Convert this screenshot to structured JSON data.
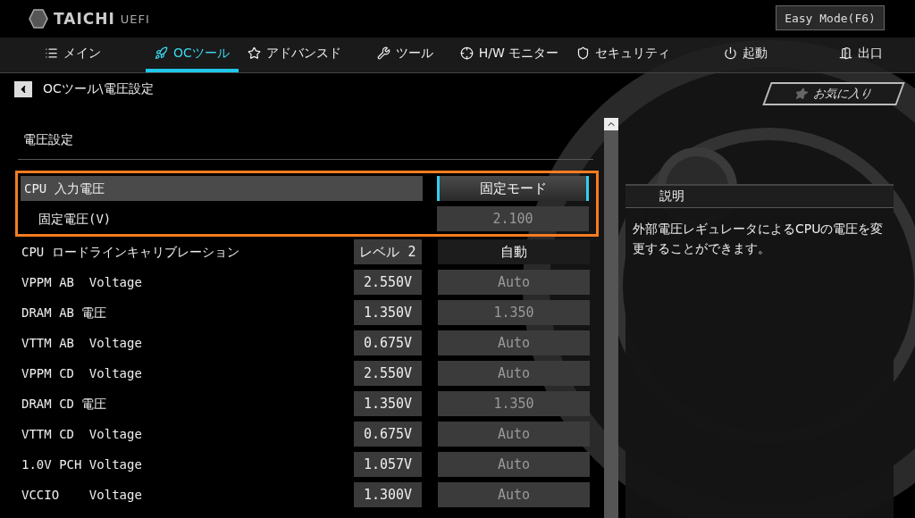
{
  "header": {
    "logo": "TAICHI",
    "logo_suffix": "UEFI",
    "mode_button": "Easy Mode(F6)"
  },
  "tabs": [
    {
      "label": "メイン",
      "selected": false
    },
    {
      "label": "OCツール",
      "selected": true
    },
    {
      "label": "アドバンスド",
      "selected": false
    },
    {
      "label": "ツール",
      "selected": false
    },
    {
      "label": "H/W モニター",
      "selected": false
    },
    {
      "label": "セキュリティ",
      "selected": false
    },
    {
      "label": "起動",
      "selected": false
    },
    {
      "label": "出口",
      "selected": false
    }
  ],
  "breadcrumb": "OCツール\\電圧設定",
  "favorites": "お気に入り",
  "section_title": "電圧設定",
  "rows": [
    {
      "label": "CPU 入力電圧",
      "selected": true,
      "outlined": true,
      "value": {
        "text": "固定モード",
        "kind": "focused"
      },
      "children": [
        {
          "label": "固定電圧(V)",
          "selected": false,
          "value": {
            "text": "2.100",
            "kind": "disabled"
          }
        }
      ]
    },
    {
      "label": "CPU ロードラインキャリブレーション",
      "selected": false,
      "outlined": false,
      "reading": "レベル 2",
      "value": {
        "text": "自動",
        "kind": "option"
      }
    },
    {
      "label": "VPPM AB  Voltage",
      "selected": false,
      "outlined": false,
      "reading": "2.550V",
      "value": {
        "text": "Auto",
        "kind": "disabled"
      }
    },
    {
      "label": "DRAM AB 電圧",
      "selected": false,
      "outlined": false,
      "reading": "1.350V",
      "value": {
        "text": "1.350",
        "kind": "disabled"
      }
    },
    {
      "label": "VTTM AB  Voltage",
      "selected": false,
      "outlined": false,
      "reading": "0.675V",
      "value": {
        "text": "Auto",
        "kind": "disabled"
      }
    },
    {
      "label": "VPPM CD  Voltage",
      "selected": false,
      "outlined": false,
      "reading": "2.550V",
      "value": {
        "text": "Auto",
        "kind": "disabled"
      }
    },
    {
      "label": "DRAM CD 電圧",
      "selected": false,
      "outlined": false,
      "reading": "1.350V",
      "value": {
        "text": "1.350",
        "kind": "disabled"
      }
    },
    {
      "label": "VTTM CD  Voltage",
      "selected": false,
      "outlined": false,
      "reading": "0.675V",
      "value": {
        "text": "Auto",
        "kind": "disabled"
      }
    },
    {
      "label": "1.0V PCH Voltage",
      "selected": false,
      "outlined": false,
      "reading": "1.057V",
      "value": {
        "text": "Auto",
        "kind": "disabled"
      }
    },
    {
      "label": "VCCIO    Voltage",
      "selected": false,
      "outlined": false,
      "reading": "1.300V",
      "value": {
        "text": "Auto",
        "kind": "disabled"
      }
    }
  ],
  "description": {
    "title": "説明",
    "text": "外部電圧レギュレータによるCPUの電圧を変更することができます。"
  }
}
